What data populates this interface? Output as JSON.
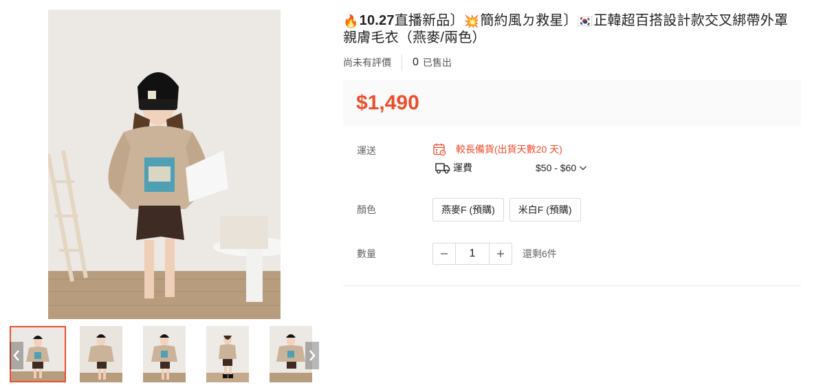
{
  "title": {
    "fire_emoji": "🔥",
    "bold_part": "10.27",
    "part1": "直播新品〕",
    "burst_emoji": "💥",
    "part2": "簡約風ㄉ救星〕",
    "flag_emoji": "🇰🇷",
    "part3": "正韓超百搭設計款交叉綁帶外罩親膚毛衣（燕麥/兩色）"
  },
  "meta": {
    "rating_text": "尚未有評價",
    "sold_count": "0",
    "sold_label": "已售出"
  },
  "price": "$1,490",
  "shipping": {
    "label": "運送",
    "preorder_text": "較長備貨(出貨天數20 天)",
    "fee_label": "運費",
    "fee_range": "$50 - $60",
    "calendar_icon": "calendar-icon",
    "truck_icon": "truck-icon"
  },
  "variation": {
    "label": "顏色",
    "options": [
      "燕麥F (預購)",
      "米白F (預購)"
    ]
  },
  "quantity": {
    "label": "數量",
    "value": "1",
    "stock_text": "還剩6件"
  },
  "colors": {
    "accent": "#ee4d2d",
    "price_bg": "#fafafa"
  }
}
